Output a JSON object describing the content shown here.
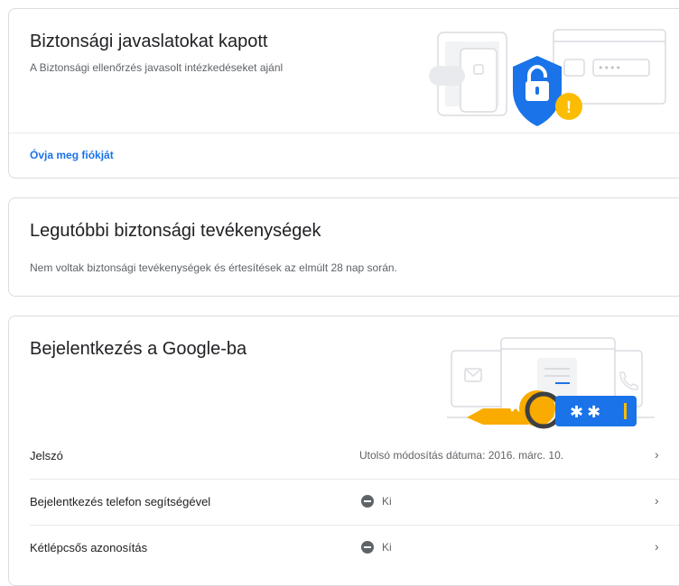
{
  "security_recommendations": {
    "title": "Biztonsági javaslatokat kapott",
    "subtitle": "A Biztonsági ellenőrzés javasolt intézkedéseket ajánl",
    "link": "Óvja meg fiókját",
    "password_dots": "••••",
    "warning_mark": "!"
  },
  "recent_activity": {
    "title": "Legutóbbi biztonsági tevékenységek",
    "message": "Nem voltak biztonsági tevékenységek és értesítések az elmúlt 28 nap során."
  },
  "signin": {
    "title": "Bejelentkezés a Google-ba",
    "password_mask": "✱✱",
    "rows": [
      {
        "label": "Jelszó",
        "value": "Utolsó módosítás dátuma: 2016. márc. 10."
      },
      {
        "label": "Bejelentkezés telefon segítségével",
        "value": "Ki"
      },
      {
        "label": "Kétlépcsős azonosítás",
        "value": "Ki"
      }
    ]
  },
  "icons": {
    "chevron": "›",
    "warning": "warning-icon",
    "shield": "shield-lock-icon",
    "key": "key-icon"
  },
  "colors": {
    "link": "#1a73e8",
    "shield": "#1a73e8",
    "warning": "#fbbc04",
    "key": "#f9ab00",
    "status_off": "#5f6368"
  }
}
